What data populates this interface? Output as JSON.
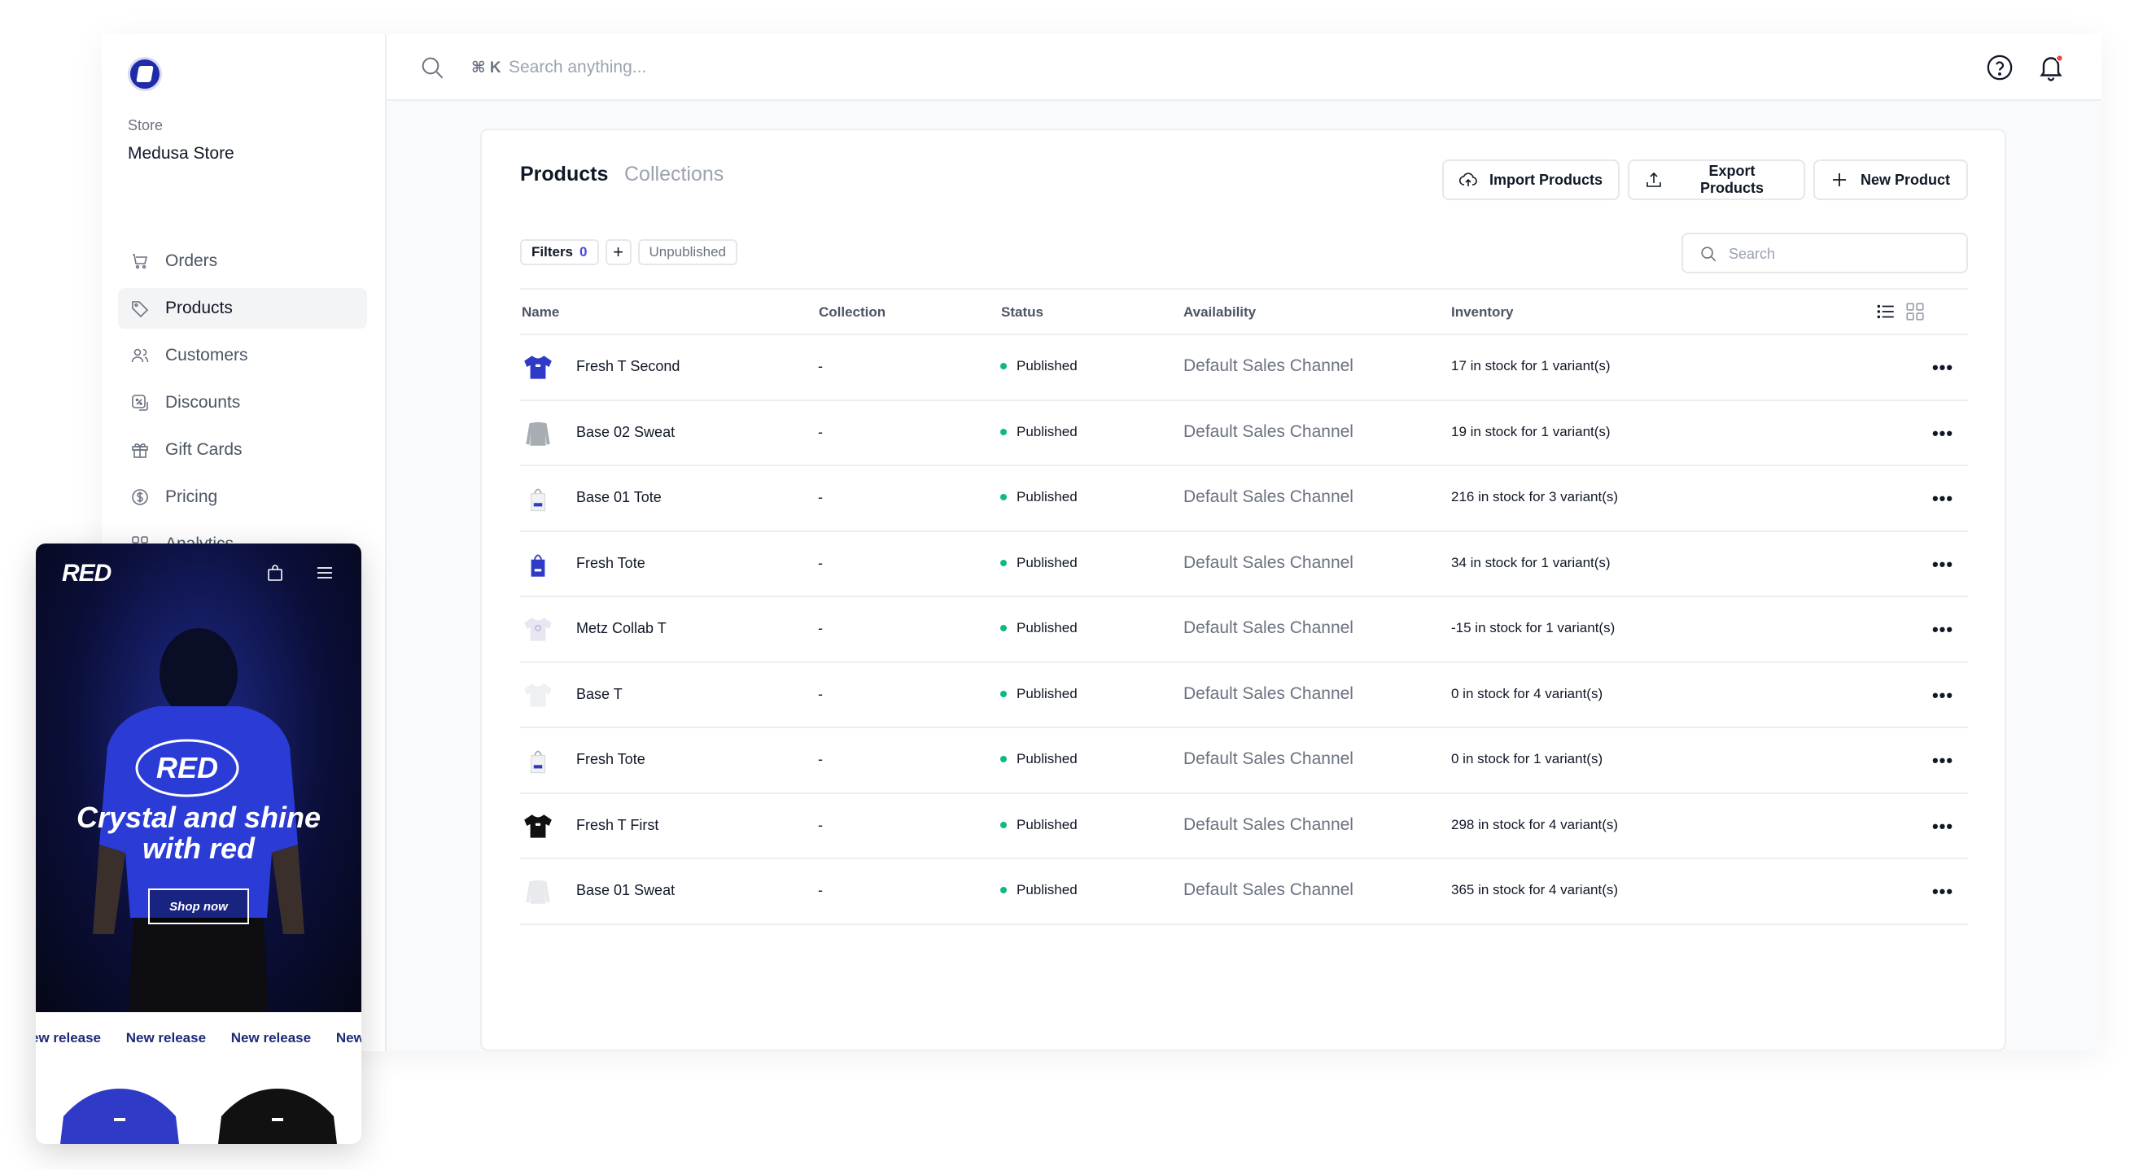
{
  "sidebar": {
    "store_kicker": "Store",
    "store_name": "Medusa Store",
    "items": [
      {
        "label": "Orders",
        "icon": "cart-icon"
      },
      {
        "label": "Products",
        "icon": "tag-icon",
        "active": true
      },
      {
        "label": "Customers",
        "icon": "users-icon"
      },
      {
        "label": "Discounts",
        "icon": "discount-icon"
      },
      {
        "label": "Gift Cards",
        "icon": "gift-icon"
      },
      {
        "label": "Pricing",
        "icon": "dollar-icon"
      },
      {
        "label": "Analytics",
        "icon": "grid-icon"
      }
    ]
  },
  "topbar": {
    "shortcut": "⌘ K",
    "search_placeholder": "Search anything..."
  },
  "page": {
    "tabs": [
      "Products",
      "Collections"
    ],
    "buttons": {
      "import": "Import Products",
      "export": "Export Products",
      "new": "New Product"
    },
    "filters": {
      "label": "Filters",
      "count": "0",
      "plus": "+",
      "chip": "Unpublished"
    },
    "search_placeholder": "Search"
  },
  "table": {
    "headers": [
      "Name",
      "Collection",
      "Status",
      "Availability",
      "Inventory"
    ],
    "rows": [
      {
        "thumb": "blue-tee",
        "name": "Fresh T Second",
        "collection": "-",
        "status": "Published",
        "availability": "Default Sales Channel",
        "inventory": "17 in stock for 1 variant(s)"
      },
      {
        "thumb": "gray-sweat",
        "name": "Base 02 Sweat",
        "collection": "-",
        "status": "Published",
        "availability": "Default Sales Channel",
        "inventory": "19 in stock for 1 variant(s)"
      },
      {
        "thumb": "white-tote",
        "name": "Base 01 Tote",
        "collection": "-",
        "status": "Published",
        "availability": "Default Sales Channel",
        "inventory": "216 in stock for 3 variant(s)"
      },
      {
        "thumb": "blue-tote",
        "name": "Fresh Tote",
        "collection": "-",
        "status": "Published",
        "availability": "Default Sales Channel",
        "inventory": "34 in stock for 1 variant(s)"
      },
      {
        "thumb": "light-tee",
        "name": "Metz Collab T",
        "collection": "-",
        "status": "Published",
        "availability": "Default Sales Channel",
        "inventory": "-15 in stock for 1 variant(s)"
      },
      {
        "thumb": "white-tee",
        "name": "Base T",
        "collection": "-",
        "status": "Published",
        "availability": "Default Sales Channel",
        "inventory": "0 in stock for 4 variant(s)"
      },
      {
        "thumb": "white-tote",
        "name": "Fresh Tote",
        "collection": "-",
        "status": "Published",
        "availability": "Default Sales Channel",
        "inventory": "0 in stock for 1 variant(s)"
      },
      {
        "thumb": "black-tee",
        "name": "Fresh T First",
        "collection": "-",
        "status": "Published",
        "availability": "Default Sales Channel",
        "inventory": "298 in stock for 4 variant(s)"
      },
      {
        "thumb": "white-sweat",
        "name": "Base 01 Sweat",
        "collection": "-",
        "status": "Published",
        "availability": "Default Sales Channel",
        "inventory": "365 in stock for 4 variant(s)"
      }
    ]
  },
  "promo": {
    "logo": "RED",
    "shirt_logo": "RED",
    "title": "Crystal and shine with red",
    "cta": "Shop now",
    "ticker": [
      "ew release",
      "New release",
      "New release",
      "New"
    ]
  },
  "colors": {
    "accent": "#4f46e5",
    "status_published": "#10b981",
    "brand_blue": "#1f2ba8",
    "promo_bg": "#0b0f3a"
  }
}
